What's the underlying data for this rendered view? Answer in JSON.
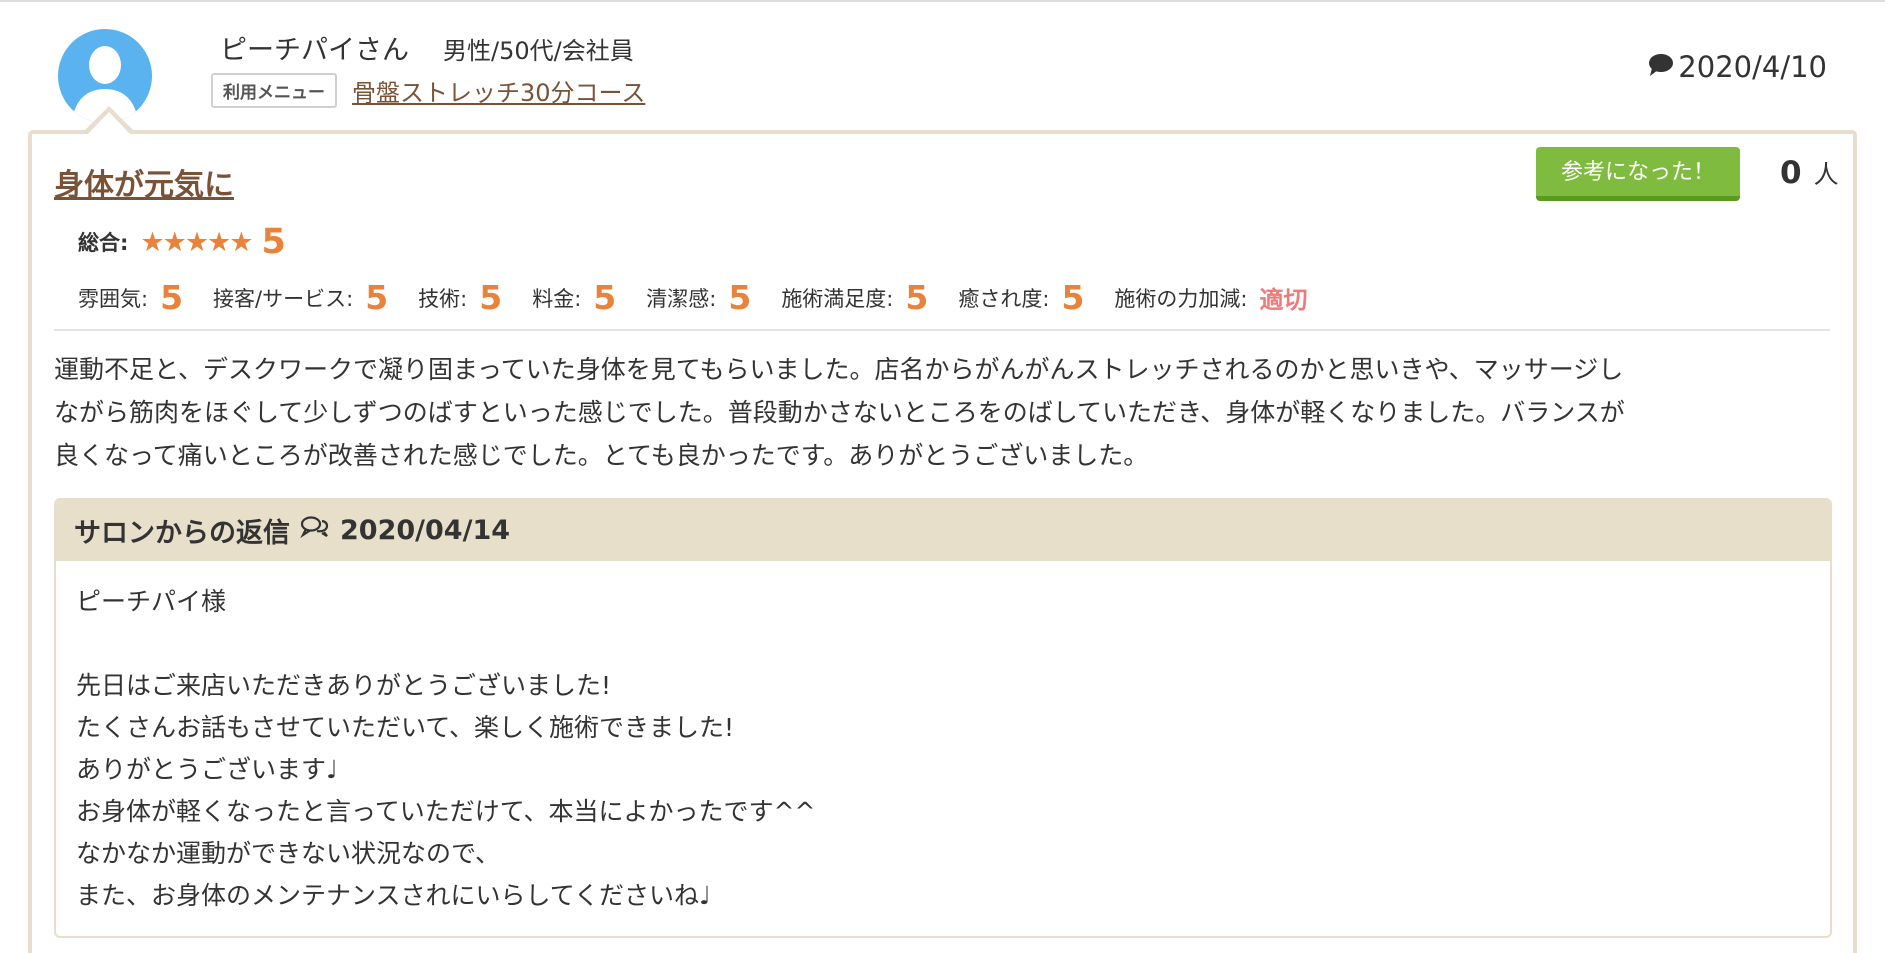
{
  "reviewer": {
    "name": "ピーチパイさん",
    "gender": "男性",
    "age": "50代",
    "occupation": "会社員",
    "separator": "/",
    "avatar_icon": "user-silhouette-icon"
  },
  "menu": {
    "tag_label": "利用メニュー",
    "link_text": "骨盤ストレッチ30分コース"
  },
  "post_date": {
    "icon": "comment-icon",
    "date": "2020/4/10"
  },
  "review": {
    "title": "身体が元気に",
    "helpful_button_label": "参考になった！",
    "helpful_count": "0",
    "helpful_unit": "人",
    "overall_label": "総合:",
    "overall_stars": "★★★★★",
    "overall_score": "5",
    "ratings": [
      {
        "label": "雰囲気:",
        "value": "5"
      },
      {
        "label": "接客/サービス:",
        "value": "5"
      },
      {
        "label": "技術:",
        "value": "5"
      },
      {
        "label": "料金:",
        "value": "5"
      },
      {
        "label": "清潔感:",
        "value": "5"
      },
      {
        "label": "施術満足度:",
        "value": "5"
      },
      {
        "label": "癒され度:",
        "value": "5"
      },
      {
        "label": "施術の力加減:",
        "value": "適切"
      }
    ],
    "body_lines": [
      "運動不足と、デスクワークで凝り固まっていた身体を見てもらいました。店名からがんがんストレッチされるのかと思いきや、マッサージし",
      "ながら筋肉をほぐして少しずつのばすといった感じでした。普段動かさないところをのばしていただき、身体が軽くなりました。バランスが",
      "良くなって痛いところが改善された感じでした。とても良かったです。ありがとうございました。"
    ]
  },
  "reply": {
    "heading": "サロンからの返信",
    "date": "2020/04/14",
    "greeting": "ピーチパイ様",
    "lines": [
      "先日はご来店いただきありがとうございました!",
      "たくさんお話もさせていただいて、楽しく施術できました!",
      "ありがとうございます♩",
      "お身体が軽くなったと言っていただけて、本当によかったです^^",
      "なかなか運動ができない状況なので、",
      "また、お身体のメンテナンスされにいらしてくださいね♩"
    ]
  },
  "colors": {
    "accent_orange": "#e9823a",
    "title_brown": "#7a5236",
    "button_green": "#7fbb3f",
    "reply_header_bg": "#e8dfcb",
    "avatar_blue": "#5ab3ee",
    "rating_text_red": "#ee7a7a"
  }
}
